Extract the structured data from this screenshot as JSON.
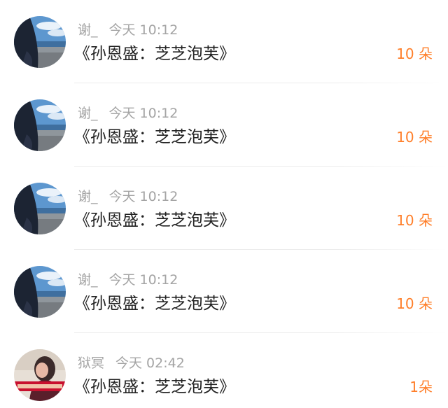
{
  "colors": {
    "accent": "#ff7f2a",
    "meta_text": "#a4a4a4",
    "title_text": "#222222"
  },
  "items": [
    {
      "username": "谢_",
      "time": "今天 10:12",
      "title": "《孙恩盛：芝芝泡芙》",
      "amount": "10 朵",
      "avatar": "seaside-photo-avatar"
    },
    {
      "username": "谢_",
      "time": "今天 10:12",
      "title": "《孙恩盛：芝芝泡芙》",
      "amount": "10 朵",
      "avatar": "seaside-photo-avatar"
    },
    {
      "username": "谢_",
      "time": "今天 10:12",
      "title": "《孙恩盛：芝芝泡芙》",
      "amount": "10 朵",
      "avatar": "seaside-photo-avatar"
    },
    {
      "username": "谢_",
      "time": "今天 10:12",
      "title": "《孙恩盛：芝芝泡芙》",
      "amount": "10 朵",
      "avatar": "seaside-photo-avatar"
    },
    {
      "username": "狱冥",
      "time": "今天 02:42",
      "title": "《孙恩盛：芝芝泡芙》",
      "amount": "1朵",
      "avatar": "portrait-photo-avatar"
    }
  ]
}
